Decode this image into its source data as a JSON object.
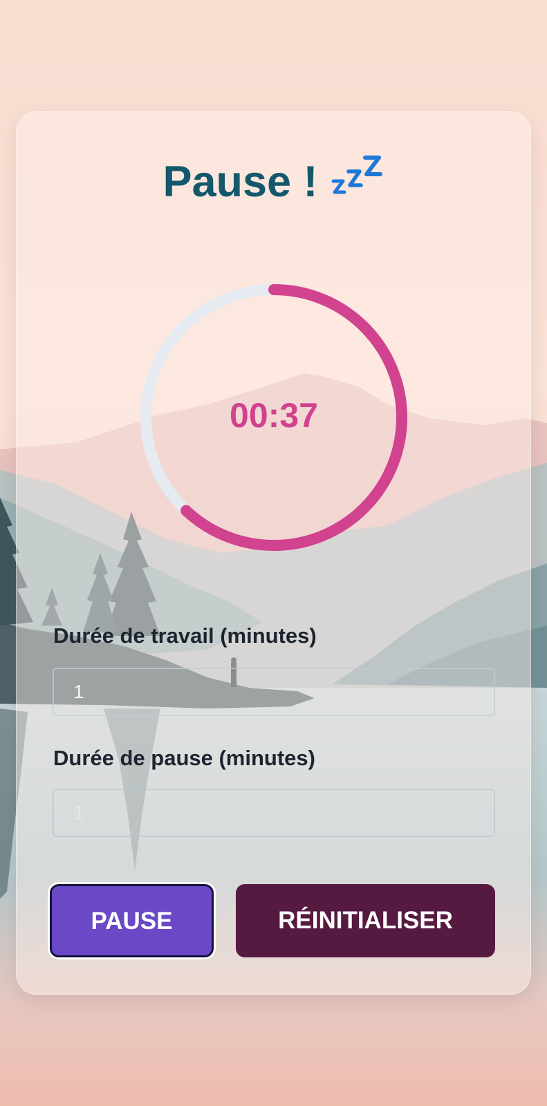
{
  "header": {
    "title": "Pause !",
    "title_icon": "sleeping-zzz-icon"
  },
  "timer": {
    "time_text": "00:37",
    "progress_remaining": 0.62,
    "progress_color": "#d1428f",
    "track_color": "#e6ebf2"
  },
  "settings": {
    "work": {
      "label": "Durée de travail (minutes)",
      "value": "1",
      "enabled": true
    },
    "break": {
      "label": "Durée de pause (minutes)",
      "value": "1",
      "enabled": false
    }
  },
  "actions": {
    "pause_label": "PAUSE",
    "reset_label": "RÉINITIALISER"
  },
  "colors": {
    "title": "#14586b",
    "pause_button": "#6a48c6",
    "reset_button": "#561a40"
  }
}
